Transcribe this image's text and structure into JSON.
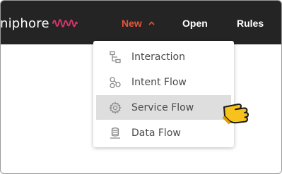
{
  "app": {
    "logo_text": "niphore",
    "brand_color": "#e8543a",
    "wave_color": "#d6336c"
  },
  "nav": {
    "new_label": "New",
    "open_label": "Open",
    "rules_label": "Rules"
  },
  "menu": {
    "items": [
      {
        "label": "Interaction",
        "icon": "hierarchy-icon"
      },
      {
        "label": "Intent Flow",
        "icon": "intent-nodes-icon"
      },
      {
        "label": "Service Flow",
        "icon": "gear-icon",
        "highlighted": true
      },
      {
        "label": "Data Flow",
        "icon": "database-icon"
      }
    ]
  },
  "cursor": {
    "icon": "hand-pointer-icon"
  }
}
